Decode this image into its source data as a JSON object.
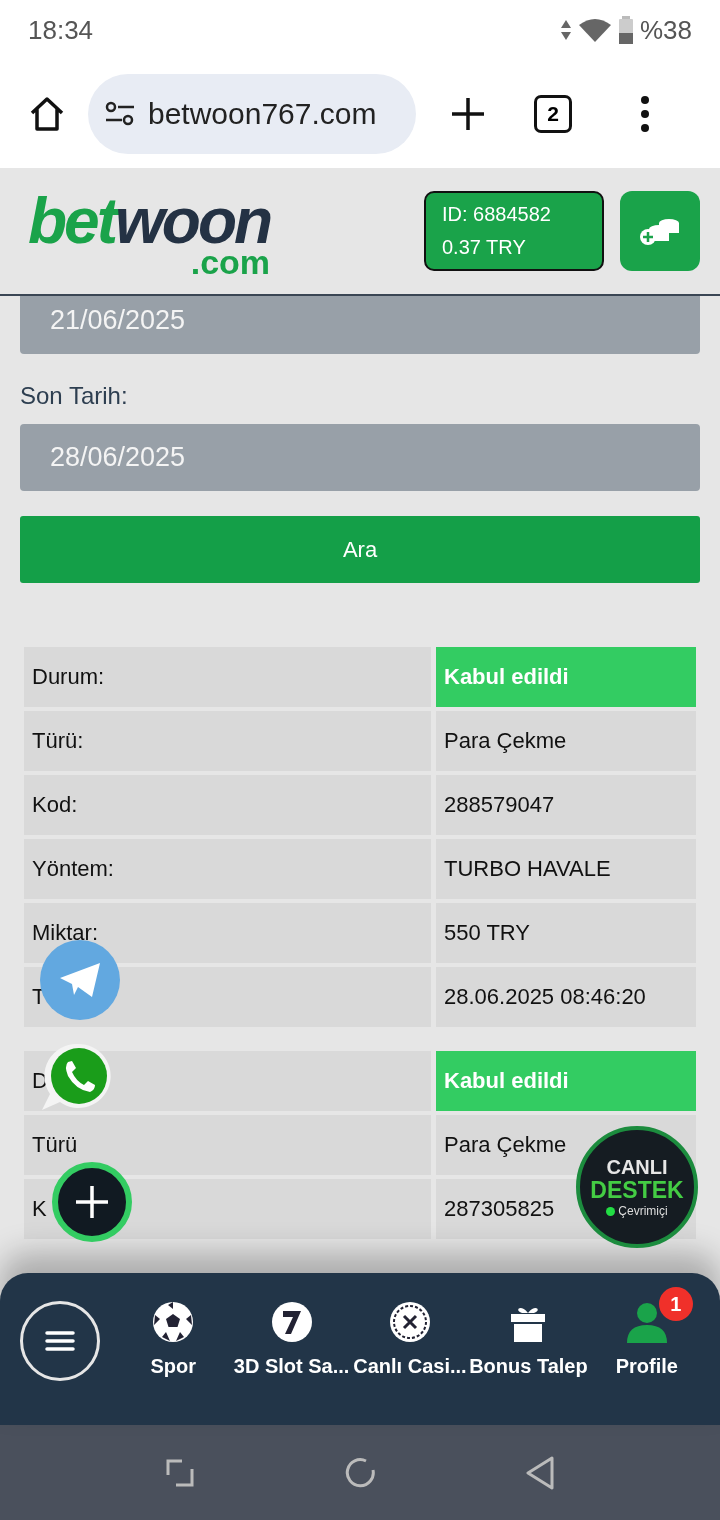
{
  "status_bar": {
    "time": "18:34",
    "battery": "%38"
  },
  "browser": {
    "url": "betwoon767.com",
    "tab_count": "2"
  },
  "header": {
    "logo_main": "bet",
    "logo_accent": "woon",
    "logo_domain": ".com",
    "account_id": "ID: 6884582",
    "balance": "0.37 TRY"
  },
  "filters": [
    {
      "value": "21/06/2025"
    },
    {
      "label": "Son Tarih:",
      "value": "28/06/2025"
    }
  ],
  "search_button": "Ara",
  "records": [
    {
      "rows": [
        {
          "label": "Durum:",
          "value": "Kabul edildi",
          "kind": "status"
        },
        {
          "label": "Türü:",
          "value": "Para Çekme",
          "kind": "text"
        },
        {
          "label": "Kod:",
          "value": "288579047",
          "kind": "text"
        },
        {
          "label": "Yöntem:",
          "value": "TURBO HAVALE",
          "kind": "text"
        },
        {
          "label": "Miktar:",
          "value": "550 TRY",
          "kind": "text"
        },
        {
          "label": "T",
          "value": "28.06.2025 08:46:20",
          "kind": "text"
        }
      ]
    },
    {
      "rows": [
        {
          "label": "D",
          "value": "Kabul edildi",
          "kind": "status"
        },
        {
          "label": "Türü",
          "value": "Para Çekme",
          "kind": "text"
        },
        {
          "label": "K",
          "value": "287305825",
          "kind": "text"
        }
      ]
    }
  ],
  "live_support": {
    "line1": "CANLI",
    "line2": "DESTEK",
    "status": "Çevrimiçi"
  },
  "bottom_nav": [
    {
      "label": "Spor",
      "kind": "soccer"
    },
    {
      "label": "3D Slot Sa...",
      "kind": "slot"
    },
    {
      "label": "Canlı Casi...",
      "kind": "roulette"
    },
    {
      "label": "Bonus Talep",
      "kind": "gift"
    },
    {
      "label": "Profile",
      "kind": "profile",
      "badge": "1"
    }
  ]
}
